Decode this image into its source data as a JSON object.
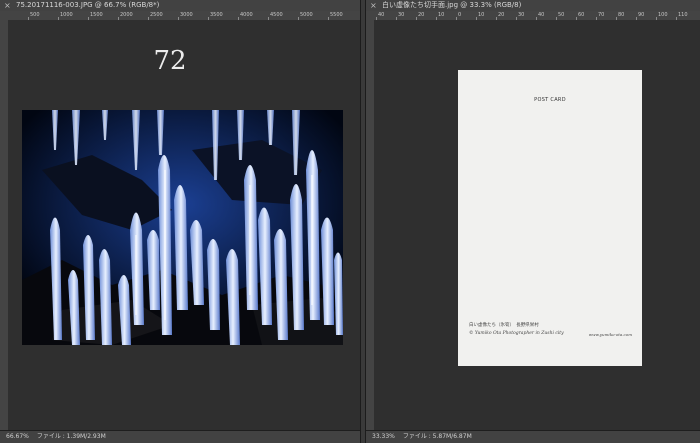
{
  "left_doc": {
    "tab_close": "×",
    "tab_title": "75.20171116-003.JPG @ 66.7% (RGB/8*)",
    "ruler_ticks": [
      "500",
      "1000",
      "1500",
      "2000",
      "2500",
      "3000",
      "3500",
      "4000",
      "4500",
      "5000",
      "5500"
    ],
    "page_number": "72",
    "status_zoom": "66.67%",
    "status_info": "ファイル : 1.39M/2.93M"
  },
  "right_doc": {
    "tab_close": "×",
    "tab_title": "白い虚像たち切手面.jpg @ 33.3% (RGB/8)",
    "ruler_ticks": [
      "40",
      "30",
      "20",
      "10",
      "0",
      "10",
      "20",
      "30",
      "40",
      "50",
      "60",
      "70",
      "80",
      "90",
      "100",
      "110"
    ],
    "postcard_header": "POST CARD",
    "postcard_caption_jp": "白い虚像たち（氷筍）　長野県栄村",
    "postcard_credit": "©  Yumiko Ota Photographer in Zushi city",
    "postcard_url": "www.yumiko-ota.com",
    "status_zoom": "33.33%",
    "status_info": "ファイル : 5.87M/6.87M"
  },
  "colors": {
    "workspace": "#282828",
    "panel_chrome": "#424242",
    "photo_background": "#020a1c",
    "ice": "#c8d8f8",
    "postcard": "#f1f1ef"
  }
}
